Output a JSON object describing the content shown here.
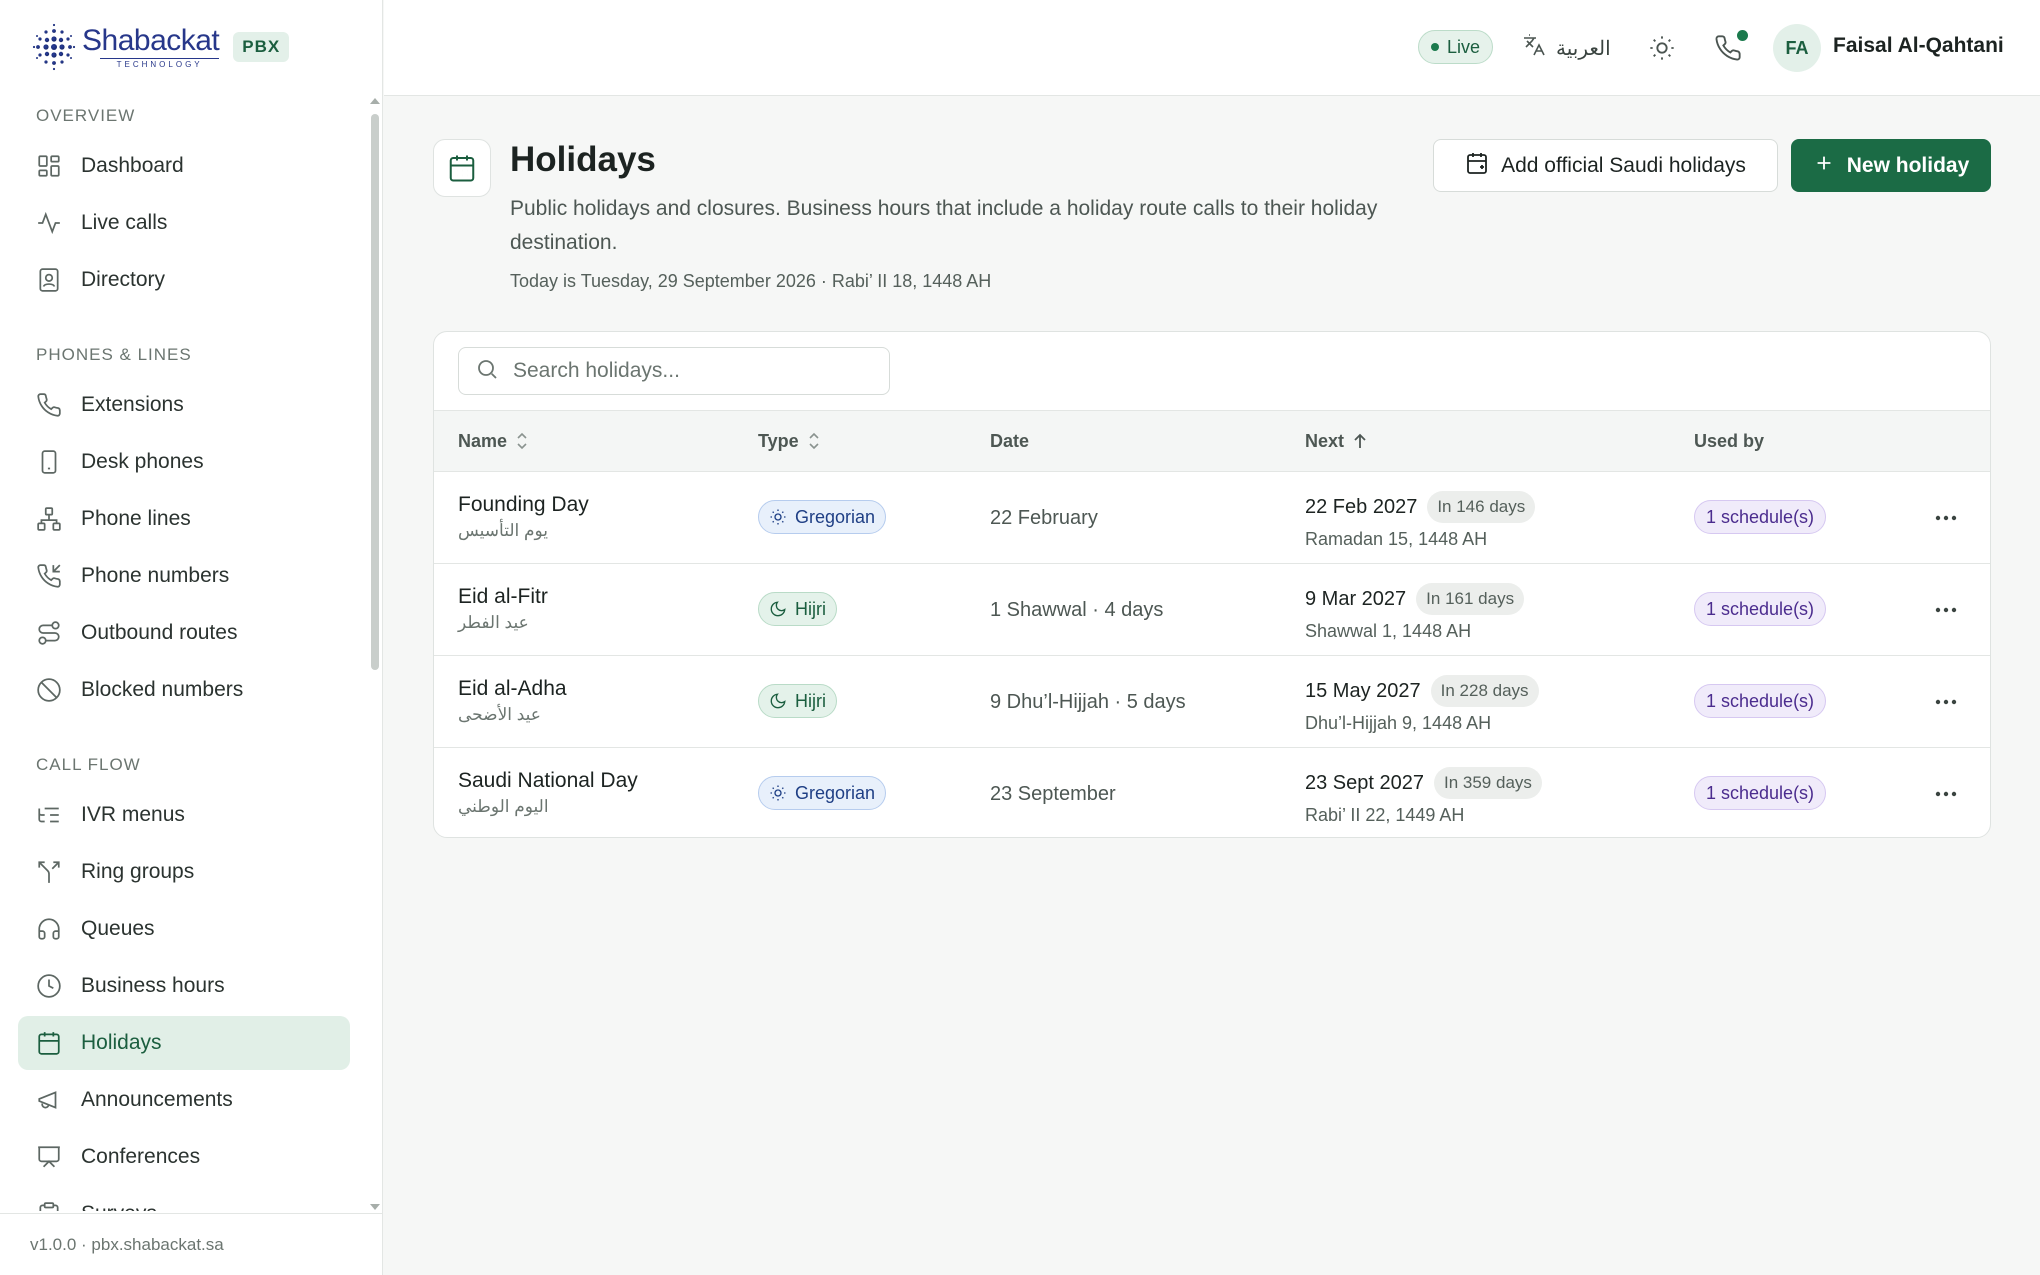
{
  "brand": {
    "name": "Shabackat",
    "sub": "TECHNOLOGY",
    "badge": "PBX"
  },
  "sidebar": {
    "sections": [
      {
        "label": "OVERVIEW",
        "items": [
          {
            "label": "Dashboard",
            "icon": "grid-icon"
          },
          {
            "label": "Live calls",
            "icon": "activity-icon"
          },
          {
            "label": "Directory",
            "icon": "contact-book-icon"
          }
        ]
      },
      {
        "label": "PHONES & LINES",
        "items": [
          {
            "label": "Extensions",
            "icon": "phone-icon"
          },
          {
            "label": "Desk phones",
            "icon": "device-icon"
          },
          {
            "label": "Phone lines",
            "icon": "network-icon"
          },
          {
            "label": "Phone numbers",
            "icon": "phone-incoming-icon"
          },
          {
            "label": "Outbound routes",
            "icon": "route-icon"
          },
          {
            "label": "Blocked numbers",
            "icon": "ban-icon"
          }
        ]
      },
      {
        "label": "CALL FLOW",
        "items": [
          {
            "label": "IVR menus",
            "icon": "list-tree-icon"
          },
          {
            "label": "Ring groups",
            "icon": "split-icon"
          },
          {
            "label": "Queues",
            "icon": "headphones-icon"
          },
          {
            "label": "Business hours",
            "icon": "clock-icon"
          },
          {
            "label": "Holidays",
            "icon": "calendar-icon",
            "active": true
          },
          {
            "label": "Announcements",
            "icon": "megaphone-icon"
          },
          {
            "label": "Conferences",
            "icon": "presentation-icon"
          },
          {
            "label": "Surveys",
            "icon": "clipboard-check-icon"
          }
        ]
      }
    ],
    "footer": "v1.0.0 · pbx.shabackat.sa"
  },
  "topbar": {
    "status": "Live",
    "language": "العربية",
    "user_initials": "FA",
    "user_name": "Faisal Al-Qahtani"
  },
  "page": {
    "title": "Holidays",
    "description": "Public holidays and closures. Business hours that include a holiday route calls to their holiday destination.",
    "today": "Today is Tuesday, 29 September 2026 · Rabi’ II 18, 1448 AH",
    "add_saudi_label": "Add official Saudi holidays",
    "new_holiday_label": "New holiday"
  },
  "search": {
    "placeholder": "Search holidays...",
    "value": ""
  },
  "table": {
    "columns": {
      "name": "Name",
      "type": "Type",
      "date": "Date",
      "next": "Next",
      "used_by": "Used by"
    },
    "rows": [
      {
        "name": "Founding Day",
        "name_ar": "يوم التأسيس",
        "type": "Gregorian",
        "date": "22 February",
        "next_date": "22 Feb 2027",
        "in_days": "In 146 days",
        "next_hijri": "Ramadan 15, 1448 AH",
        "used_by": "1 schedule(s)"
      },
      {
        "name": "Eid al-Fitr",
        "name_ar": "عيد الفطر",
        "type": "Hijri",
        "date": "1 Shawwal · 4 days",
        "next_date": "9 Mar 2027",
        "in_days": "In 161 days",
        "next_hijri": "Shawwal 1, 1448 AH",
        "used_by": "1 schedule(s)"
      },
      {
        "name": "Eid al-Adha",
        "name_ar": "عيد الأضحى",
        "type": "Hijri",
        "date": "9 Dhu’l-Hijjah · 5 days",
        "next_date": "15 May 2027",
        "in_days": "In 228 days",
        "next_hijri": "Dhu’l-Hijjah 9, 1448 AH",
        "used_by": "1 schedule(s)"
      },
      {
        "name": "Saudi National Day",
        "name_ar": "اليوم الوطني",
        "type": "Gregorian",
        "date": "23 September",
        "next_date": "23 Sept 2027",
        "in_days": "In 359 days",
        "next_hijri": "Rabi’ II 22, 1449 AH",
        "used_by": "1 schedule(s)"
      }
    ]
  },
  "colors": {
    "accent": "#1b6b45",
    "active_bg": "#e1efe7",
    "hijri": "#1b5e3f",
    "gregorian": "#1f3f85",
    "used_by": "#4b2c8e"
  }
}
